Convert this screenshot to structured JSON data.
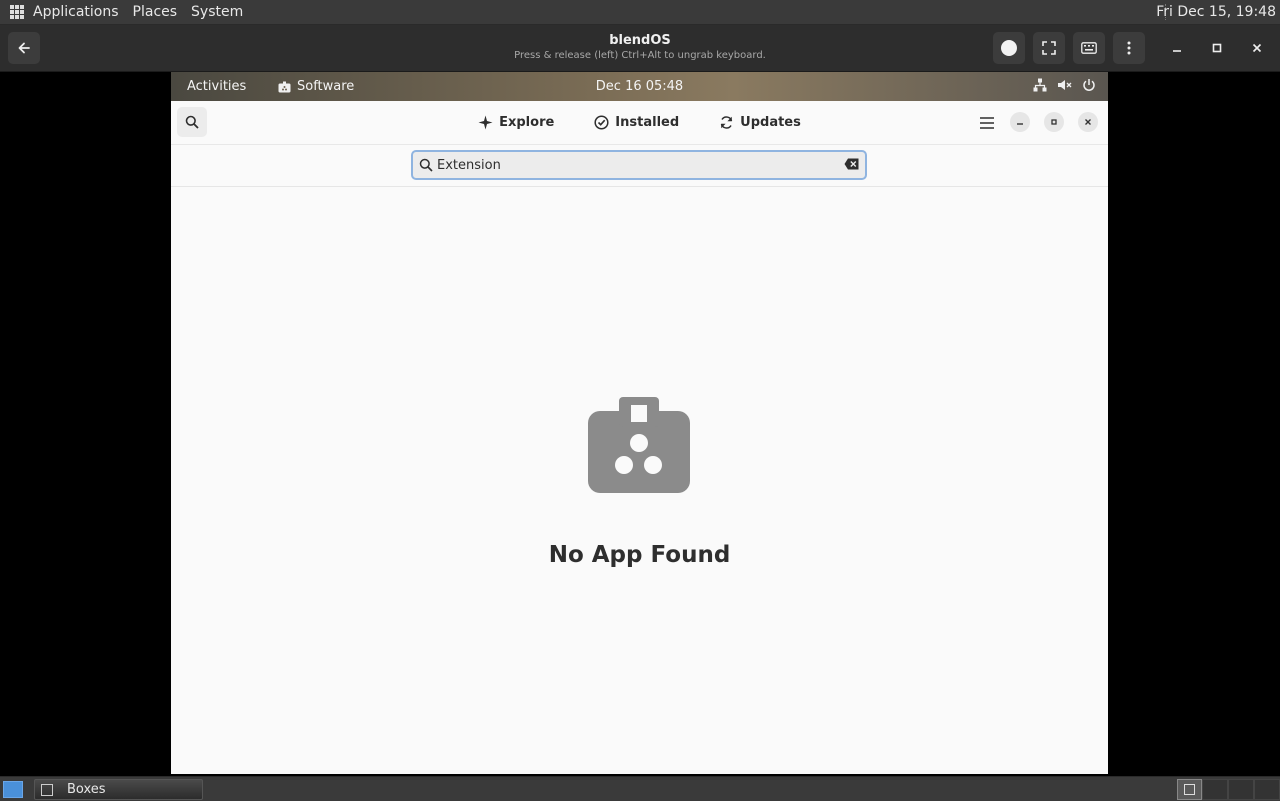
{
  "host_panel": {
    "menus": [
      "Applications",
      "Places",
      "System"
    ],
    "clock": "Fri Dec 15, 19:48"
  },
  "boxes_header": {
    "title": "blendOS",
    "subtitle": "Press & release (left) Ctrl+Alt to ungrab keyboard."
  },
  "guest_topbar": {
    "activities": "Activities",
    "app_name": "Software",
    "clock": "Dec 16  05:48"
  },
  "software": {
    "tabs": [
      {
        "label": "Explore",
        "icon": "explore-icon"
      },
      {
        "label": "Installed",
        "icon": "installed-check-icon"
      },
      {
        "label": "Updates",
        "icon": "updates-refresh-icon"
      }
    ],
    "search": {
      "value": "Extension"
    },
    "empty_state": {
      "title": "No App Found",
      "icon": "software-bag-icon"
    }
  },
  "taskbar": {
    "window_label": "Boxes"
  },
  "colors": {
    "focus_ring": "#8fb4e0",
    "accent_blue": "#4a90d9"
  }
}
